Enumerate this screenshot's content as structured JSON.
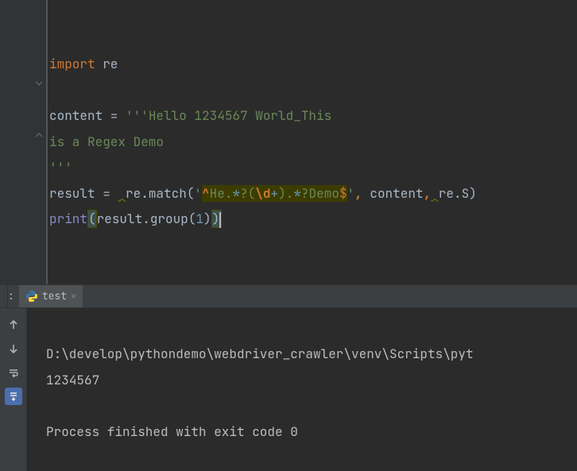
{
  "editor": {
    "lines": {
      "l1_import": "import",
      "l1_re": " re",
      "l3_content": "content = ",
      "l3_strstart": "'''",
      "l3_hello": "Hello 1234567 World_This",
      "l4_line": "is a Regex Demo",
      "l5_strend": "'''",
      "l6_result": "result = ",
      "l6_rematch": "re.match(",
      "l6_q1": "'",
      "l6_caret": "^",
      "l6_he": "He",
      "l6_dot1": ".",
      "l6_star1": "*",
      "l6_q": "?",
      "l6_lp": "(",
      "l6_esc": "\\d",
      "l6_plus": "+",
      "l6_rp": ")",
      "l6_dot2": ".",
      "l6_star2": "*",
      "l6_q2": "?",
      "l6_demo": "Demo",
      "l6_dollar": "$",
      "l6_q3": "'",
      "l6_comma1": ", ",
      "l6_content2": "content",
      "l6_comma2": ",",
      "l6_res": "re.S)",
      "l7_print": "print",
      "l7_open": "(",
      "l7_resultgroup": "result.group(",
      "l7_one": "1",
      "l7_close1": ")",
      "l7_close2": ")"
    }
  },
  "tabs": {
    "run_label_suffix": ":",
    "tab_name": "test"
  },
  "console": {
    "path": "D:\\develop\\pythondemo\\webdriver_crawler\\venv\\Scripts\\pyt",
    "output": "1234567",
    "blank": "",
    "exit": "Process finished with exit code 0"
  }
}
